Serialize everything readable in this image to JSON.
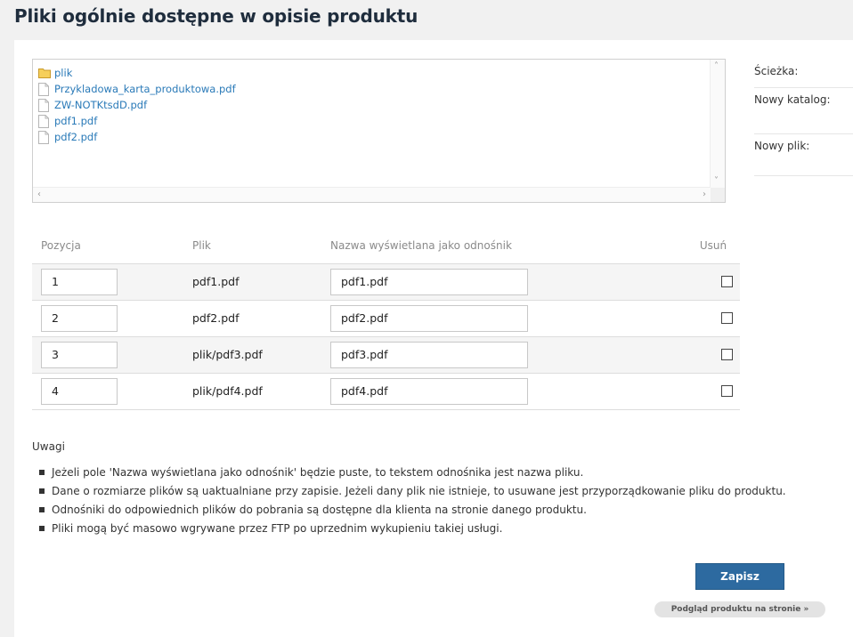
{
  "page": {
    "title": "Pliki ogólnie dostępne w opisie produktu"
  },
  "browser": {
    "items": [
      {
        "name": "plik",
        "type": "folder"
      },
      {
        "name": "Przykladowa_karta_produktowa.pdf",
        "type": "file"
      },
      {
        "name": "ZW-NOTKtsdD.pdf",
        "type": "file"
      },
      {
        "name": "pdf1.pdf",
        "type": "file"
      },
      {
        "name": "pdf2.pdf",
        "type": "file"
      }
    ]
  },
  "side": {
    "path_label": "Ścieżka:",
    "new_folder_label": "Nowy katalog:",
    "new_file_label": "Nowy plik:"
  },
  "table": {
    "headers": {
      "position": "Pozycja",
      "file": "Plik",
      "display_name": "Nazwa wyświetlana jako odnośnik",
      "delete": "Usuń"
    },
    "rows": [
      {
        "position": "1",
        "file": "pdf1.pdf",
        "display_name": "pdf1.pdf",
        "delete": false
      },
      {
        "position": "2",
        "file": "pdf2.pdf",
        "display_name": "pdf2.pdf",
        "delete": false
      },
      {
        "position": "3",
        "file": "plik/pdf3.pdf",
        "display_name": "pdf3.pdf",
        "delete": false
      },
      {
        "position": "4",
        "file": "plik/pdf4.pdf",
        "display_name": "pdf4.pdf",
        "delete": false
      }
    ]
  },
  "notes": {
    "title": "Uwagi",
    "items": [
      "Jeżeli pole 'Nazwa wyświetlana jako odnośnik' będzie puste, to tekstem odnośnika jest nazwa pliku.",
      "Dane o rozmiarze plików są uaktualniane przy zapisie. Jeżeli dany plik nie istnieje, to usuwane jest przyporządkowanie pliku do produktu.",
      "Odnośniki do odpowiednich plików do pobrania są dostępne dla klienta na stronie danego produktu.",
      "Pliki mogą być masowo wgrywane przez FTP po uprzednim wykupieniu takiej usługi."
    ]
  },
  "actions": {
    "save_label": "Zapisz",
    "preview_label": "Podgląd produktu na stronie »"
  },
  "colors": {
    "link": "#2a7ab8",
    "primary_button": "#2d6aa0",
    "folder": "#f0c04a"
  }
}
